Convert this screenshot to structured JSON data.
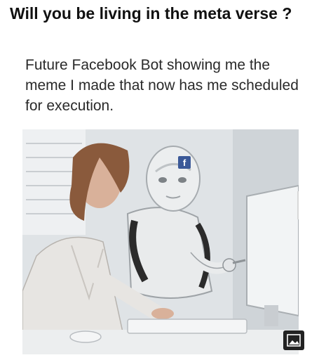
{
  "post": {
    "title": "Will you be living in the meta verse ?"
  },
  "meme": {
    "caption": "Future Facebook Bot showing me the meme I made that now has me scheduled for execution.",
    "robot_badge_letter": "f"
  },
  "icons": {
    "image_badge": "image-icon"
  },
  "colors": {
    "facebook_blue": "#3b5998",
    "photo_background": "#dfe3e6"
  }
}
